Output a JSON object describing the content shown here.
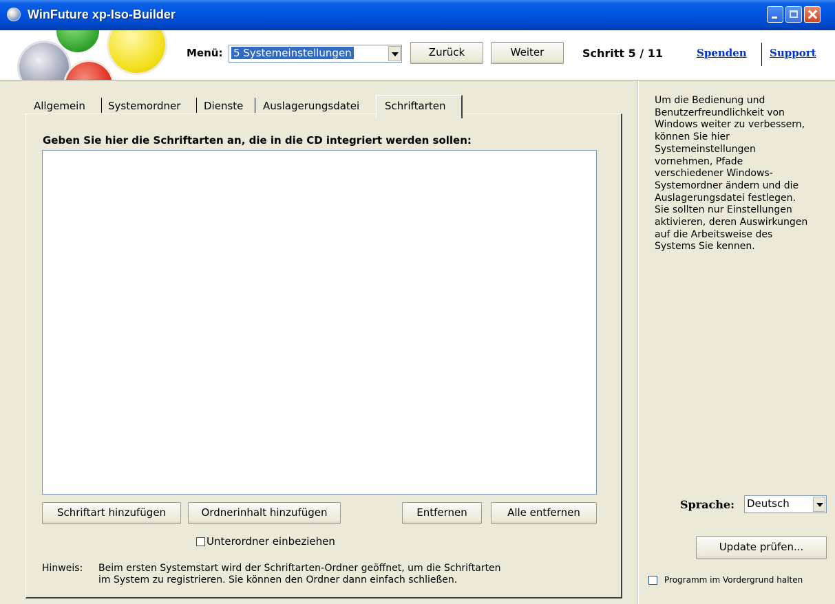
{
  "window": {
    "title": "WinFuture xp-Iso-Builder"
  },
  "toolbar": {
    "menu_label": "Menü:",
    "menu_selected": "5 Systemeinstellungen",
    "back_label": "Zurück",
    "next_label": "Weiter",
    "step_text": "Schritt 5 / 11",
    "donate_label": "Spenden",
    "support_label": "Support"
  },
  "tabs": [
    {
      "label": "Allgemein",
      "active": false
    },
    {
      "label": "Systemordner",
      "active": false
    },
    {
      "label": "Dienste",
      "active": false
    },
    {
      "label": "Auslagerungsdatei",
      "active": false
    },
    {
      "label": "Schriftarten",
      "active": true
    }
  ],
  "fonts_page": {
    "instruction": "Geben Sie hier die Schriftarten an, die in die CD integriert werden sollen:",
    "list_items": [],
    "add_font_label": "Schriftart hinzufügen",
    "add_folder_label": "Ordnerinhalt hinzufügen",
    "remove_label": "Entfernen",
    "remove_all_label": "Alle entfernen",
    "subfolders_label": "Unterordner einbeziehen",
    "subfolders_checked": false,
    "hint_label": "Hinweis:",
    "hint_line1": "Beim ersten Systemstart wird der Schriftarten-Ordner geöffnet, um die Schriftarten",
    "hint_line2": "im System zu registrieren. Sie können den Ordner dann einfach schließen."
  },
  "sidebar": {
    "help_text": "Um die Bedienung und Benutzerfreundlichkeit von Windows weiter zu verbessern, können Sie hier Systemeinstellungen vornehmen, Pfade verschiedener Windows-Systemordner ändern und die Auslagerungsdatei festlegen. Sie sollten nur Einstellungen aktivieren, deren Auswirkungen auf die Arbeitsweise des Systems Sie kennen.",
    "language_label": "Sprache:",
    "language_selected": "Deutsch",
    "update_label": "Update prüfen...",
    "stay_on_top_label": "Programm im Vordergrund halten",
    "stay_on_top_checked": false
  }
}
